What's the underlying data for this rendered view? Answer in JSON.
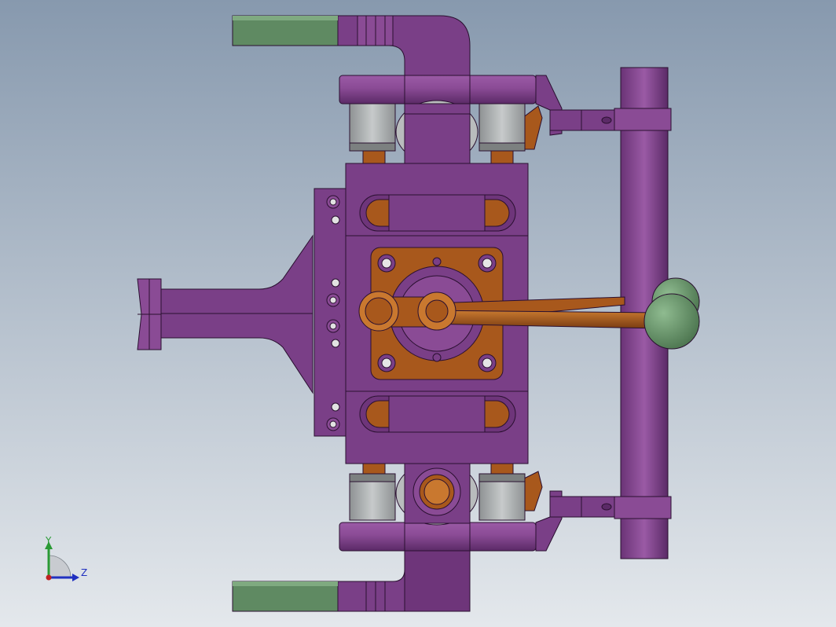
{
  "viewport": {
    "background_top": "#8799ae",
    "background_bottom": "#e4e8ec"
  },
  "colors": {
    "purple": "#7a3f87",
    "purple_light": "#95569e",
    "purple_dark": "#5b2a67",
    "edge": "#2a1030",
    "orange": "#a8581c",
    "orange_light": "#c9782f",
    "orange_dark": "#6f3510",
    "green": "#5f8a62",
    "green_light": "#7faa80",
    "grey": "#9da1a2",
    "grey_light": "#c6c9ca"
  },
  "triad": {
    "y_label": "Y",
    "z_label": "Z",
    "y_color": "#2a9a35",
    "z_color": "#2030c0",
    "x_color": "#c02020"
  }
}
